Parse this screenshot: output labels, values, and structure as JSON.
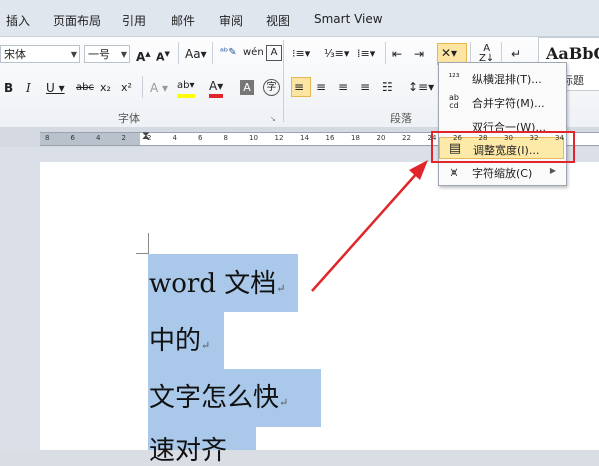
{
  "tabs": [
    "插入",
    "页面布局",
    "引用",
    "邮件",
    "审阅",
    "视图",
    "Smart View"
  ],
  "ribbon": {
    "font_name": "宋体",
    "font_size": "一号",
    "groups": {
      "font": "字体",
      "paragraph": "段落"
    },
    "styles": {
      "preview": "AaBbC",
      "label": "标题"
    }
  },
  "ruler_ticks": [
    "8",
    "6",
    "4",
    "2",
    "2",
    "4",
    "6",
    "8",
    "10",
    "12",
    "14",
    "16",
    "18",
    "20",
    "22",
    "24",
    "26",
    "28",
    "30",
    "32",
    "34"
  ],
  "document_lines": [
    "word 文档",
    "中的",
    "文字怎么快",
    "速对齐"
  ],
  "paragraph_mark": "↵",
  "menu": {
    "items": [
      {
        "label": "纵横混排(T)...",
        "icon": "vertical-horizontal-icon"
      },
      {
        "label": "合并字符(M)...",
        "icon": "combine-chars-icon"
      },
      {
        "label": "双行合一(W)...",
        "icon": "two-lines-icon"
      },
      {
        "label": "调整宽度(I)...",
        "icon": "adjust-width-icon"
      },
      {
        "label": "字符缩放(C)",
        "icon": "char-scale-icon"
      }
    ]
  },
  "colors": {
    "highlight": "#a9c8ea",
    "annotation_red": "#e0262b",
    "menu_hover": "#fde9a8"
  }
}
